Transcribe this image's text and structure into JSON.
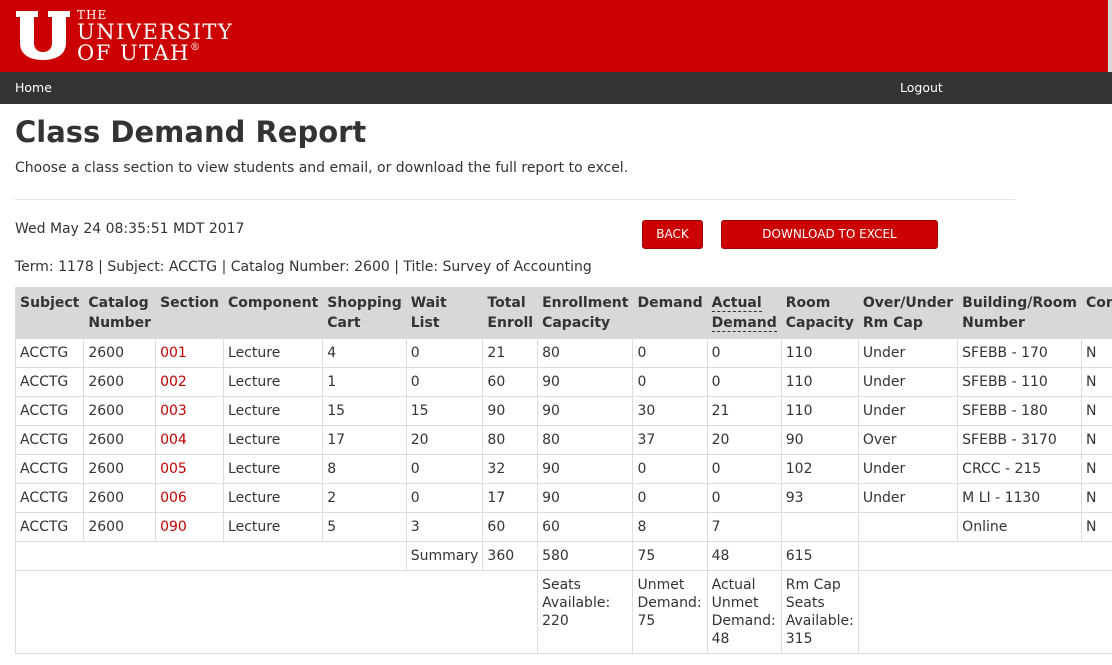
{
  "header": {
    "logo_the": "THE",
    "logo_university": "UNIVERSITY",
    "logo_of_utah": "OF UTAH",
    "logo_reg": "®",
    "brand_color": "#cc0000"
  },
  "nav": {
    "home": "Home",
    "logout": "Logout"
  },
  "page": {
    "title": "Class Demand Report",
    "subtitle": "Choose a class section to view students and email, or download the full report to excel.",
    "timestamp": "Wed May 24 08:35:51 MDT 2017",
    "back_label": "BACK",
    "download_label": "DOWNLOAD TO EXCEL",
    "term_line": "Term: 1178 | Subject: ACCTG | Catalog Number: 2600 | Title: Survey of Accounting"
  },
  "table": {
    "headers": {
      "subject": "Subject",
      "catalog_1": "Catalog",
      "catalog_2": "Number",
      "section": "Section",
      "component": "Component",
      "shopping_1": "Shopping",
      "shopping_2": "Cart",
      "waitlist": "Wait List",
      "total_1": "Total",
      "total_2": "Enroll",
      "enrollment_1": "Enrollment",
      "enrollment_2": "Capacity",
      "demand": "Demand",
      "actual_1": "Actual",
      "actual_2": "Demand",
      "room_1": "Room",
      "room_2": "Capacity",
      "overunder_1": "Over/Under",
      "overunder_2": "Rm Cap",
      "building_1": "Building/Room",
      "building_2": "Number",
      "consent": "Consent"
    },
    "rows": [
      {
        "subject": "ACCTG",
        "catalog": "2600",
        "section": "001",
        "component": "Lecture",
        "cart": "4",
        "waitlist": "0",
        "total": "21",
        "capacity": "80",
        "demand": "0",
        "actual": "0",
        "room_cap": "110",
        "over_under": "Under",
        "building": "SFEBB - 170",
        "consent": "N"
      },
      {
        "subject": "ACCTG",
        "catalog": "2600",
        "section": "002",
        "component": "Lecture",
        "cart": "1",
        "waitlist": "0",
        "total": "60",
        "capacity": "90",
        "demand": "0",
        "actual": "0",
        "room_cap": "110",
        "over_under": "Under",
        "building": "SFEBB - 110",
        "consent": "N"
      },
      {
        "subject": "ACCTG",
        "catalog": "2600",
        "section": "003",
        "component": "Lecture",
        "cart": "15",
        "waitlist": "15",
        "total": "90",
        "capacity": "90",
        "demand": "30",
        "actual": "21",
        "room_cap": "110",
        "over_under": "Under",
        "building": "SFEBB - 180",
        "consent": "N"
      },
      {
        "subject": "ACCTG",
        "catalog": "2600",
        "section": "004",
        "component": "Lecture",
        "cart": "17",
        "waitlist": "20",
        "total": "80",
        "capacity": "80",
        "demand": "37",
        "actual": "20",
        "room_cap": "90",
        "over_under": "Over",
        "building": "SFEBB - 3170",
        "consent": "N"
      },
      {
        "subject": "ACCTG",
        "catalog": "2600",
        "section": "005",
        "component": "Lecture",
        "cart": "8",
        "waitlist": "0",
        "total": "32",
        "capacity": "90",
        "demand": "0",
        "actual": "0",
        "room_cap": "102",
        "over_under": "Under",
        "building": "CRCC - 215",
        "consent": "N"
      },
      {
        "subject": "ACCTG",
        "catalog": "2600",
        "section": "006",
        "component": "Lecture",
        "cart": "2",
        "waitlist": "0",
        "total": "17",
        "capacity": "90",
        "demand": "0",
        "actual": "0",
        "room_cap": "93",
        "over_under": "Under",
        "building": "M LI - 1130",
        "consent": "N"
      },
      {
        "subject": "ACCTG",
        "catalog": "2600",
        "section": "090",
        "component": "Lecture",
        "cart": "5",
        "waitlist": "3",
        "total": "60",
        "capacity": "60",
        "demand": "8",
        "actual": "7",
        "room_cap": "",
        "over_under": "",
        "building": "Online",
        "consent": "N"
      }
    ],
    "summary": {
      "label": "Summary",
      "total": "360",
      "capacity": "580",
      "demand": "75",
      "actual": "48",
      "room_cap": "615"
    },
    "footer": {
      "seats_1": "Seats",
      "seats_2": "Available:",
      "seats_val": "220",
      "unmet_1": "Unmet",
      "unmet_2": "Demand:",
      "unmet_val": "75",
      "actual_1": "Actual",
      "actual_2": "Unmet",
      "actual_3": "Demand:",
      "actual_val": "48",
      "rm_1": "Rm Cap",
      "rm_2": "Seats",
      "rm_3": "Available:",
      "rm_val": "315"
    }
  }
}
